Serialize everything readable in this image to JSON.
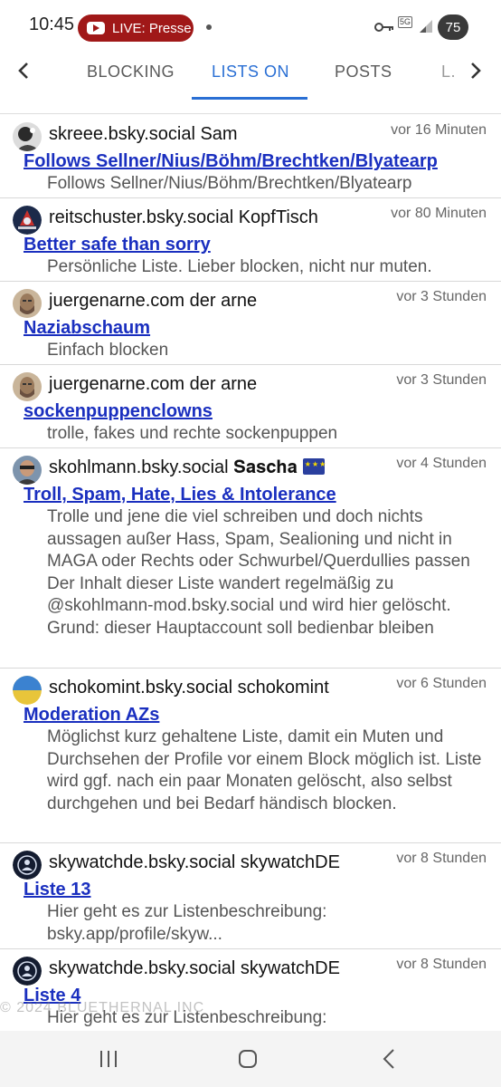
{
  "status_bar": {
    "time": "10:45",
    "live_label": "LIVE: Presse",
    "network": "5G",
    "battery": "75"
  },
  "tabs": {
    "items": [
      {
        "label": "BLOCKING",
        "active": false
      },
      {
        "label": "LISTS ON",
        "active": true
      },
      {
        "label": "POSTS",
        "active": false
      },
      {
        "label": "L.",
        "active": false
      }
    ]
  },
  "lists": [
    {
      "author": "skreee.bsky.social Sam",
      "time": "vor 16 Minuten",
      "title": "Follows Sellner/Nius/Böhm/Brechtken/Blyatearp",
      "description": "Follows Sellner/Nius/Böhm/Brechtken/Blyatearp",
      "avatar_color": "#222222"
    },
    {
      "author": "reitschuster.bsky.social KopfTisch",
      "time": "vor 80 Minuten",
      "title": "Better safe than sorry",
      "description": "Persönliche Liste. Lieber blocken, nicht nur muten.",
      "avatar_color": "#1c2a4a"
    },
    {
      "author": "juergenarne.com der arne",
      "time": "vor 3 Stunden",
      "title": "Naziabschaum",
      "description": "Einfach blocken",
      "avatar_color": "#8a7058"
    },
    {
      "author": "juergenarne.com der arne",
      "time": "vor 3 Stunden",
      "title": "sockenpuppenclowns",
      "description": "trolle, fakes und rechte sockenpuppen",
      "avatar_color": "#8a7058"
    },
    {
      "author": "skohlmann.bsky.social 𝐒𝐚𝐬𝐜𝐡𝐚",
      "time": "vor 4 Stunden",
      "title": "Troll, Spam, Hate, Lies & Intolerance",
      "description": "Trolle und jene die viel schreiben und doch nichts aussagen außer Hass, Spam, Sealioning und nicht in MAGA oder Rechts oder Schwurbel/Querdullies passen Der Inhalt dieser Liste wandert regelmäßig zu @skohlmann-mod.bsky.social und wird hier gelöscht. Grund: dieser Hauptaccount soll bedienbar bleiben",
      "avatar_color": "#5a6e86"
    },
    {
      "author": "schokomint.bsky.social schokomint",
      "time": "vor 6 Stunden",
      "title": "Moderation AZs",
      "description": "Möglichst kurz gehaltene Liste, damit ein Muten und Durchsehen der Profile vor einem Block möglich ist. Liste wird ggf. nach ein paar Monaten gelöscht, also selbst durchgehen und bei Bedarf händisch blocken.",
      "avatar_color": "#3b82d0"
    },
    {
      "author": "skywatchde.bsky.social skywatchDE",
      "time": "vor 8 Stunden",
      "title": "Liste 13",
      "description": "Hier geht es zur Listenbeschreibung: bsky.app/profile/skyw...",
      "avatar_color": "#141c30"
    },
    {
      "author": "skywatchde.bsky.social skywatchDE",
      "time": "vor 8 Stunden",
      "title": "Liste 4",
      "description": "Hier geht es zur Listenbeschreibung:",
      "avatar_color": "#141c30"
    }
  ],
  "watermark": "© 2024 BLUETHERNAL INC",
  "icons": {
    "back": "chevron-left-icon",
    "forward": "chevron-right-icon",
    "recents": "recents-icon",
    "home": "home-icon",
    "back_nav": "back-icon"
  }
}
